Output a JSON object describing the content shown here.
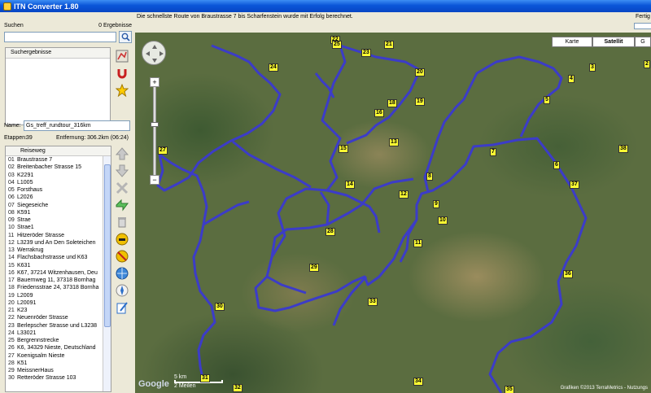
{
  "window": {
    "title": "ITN Converter 1.80"
  },
  "status": {
    "message": "Die schnellste Route von Braustrasse 7 bis Scharfenstein wurde mit Erfolg berechnet.",
    "ready": "Fertig"
  },
  "search": {
    "label": "Suchen",
    "result_count": "0 Ergebnisse",
    "results_header": "Suchergebnisse"
  },
  "route": {
    "name_label": "Name:",
    "name_value": "Gs_treff_rundtour_316km",
    "stages_label": "Etappen:",
    "stages_value": "39",
    "distance_label": "Entfernung:",
    "distance_value": "306.2km (06:24)"
  },
  "list": {
    "header": "Reiseweg",
    "rows": [
      {
        "num": "01",
        "name": "Braustrasse 7"
      },
      {
        "num": "02",
        "name": "Breitenbacher Strasse 15"
      },
      {
        "num": "03",
        "name": "K2291"
      },
      {
        "num": "04",
        "name": "L1005"
      },
      {
        "num": "05",
        "name": "Forsthaus"
      },
      {
        "num": "06",
        "name": "L2026"
      },
      {
        "num": "07",
        "name": "Siegeseiche"
      },
      {
        "num": "08",
        "name": "K591"
      },
      {
        "num": "09",
        "name": "Strae"
      },
      {
        "num": "10",
        "name": "Strae1"
      },
      {
        "num": "11",
        "name": "Hitzeröder Strasse"
      },
      {
        "num": "12",
        "name": "L3239 und An Den Soleteichen"
      },
      {
        "num": "13",
        "name": "Werrakrug"
      },
      {
        "num": "14",
        "name": "Flachsbachstrasse und K63"
      },
      {
        "num": "15",
        "name": "K631"
      },
      {
        "num": "16",
        "name": "K67, 37214 Witzenhausen, Deu"
      },
      {
        "num": "17",
        "name": "Bauernweg 11, 37318 Bornhag"
      },
      {
        "num": "18",
        "name": "Friedensstrae 24, 37318 Bornha"
      },
      {
        "num": "19",
        "name": "L2009"
      },
      {
        "num": "20",
        "name": "L20091"
      },
      {
        "num": "21",
        "name": "K23"
      },
      {
        "num": "22",
        "name": "Neuenröder Strasse"
      },
      {
        "num": "23",
        "name": "Berlepscher Strasse und L3238"
      },
      {
        "num": "24",
        "name": "L33021"
      },
      {
        "num": "25",
        "name": "Bergrennstrecke"
      },
      {
        "num": "26",
        "name": "K6, 34329 Nieste, Deutschland"
      },
      {
        "num": "27",
        "name": "Koenigsalm Nieste"
      },
      {
        "num": "28",
        "name": "K51"
      },
      {
        "num": "29",
        "name": "MeissnerHaus"
      },
      {
        "num": "30",
        "name": "Retteröder Strasse 103"
      }
    ]
  },
  "map": {
    "buttons": {
      "map": "Karte",
      "satellite": "Satellit",
      "extra": "G"
    },
    "google": "Google",
    "scale_km": "5 km",
    "scale_mi": "2 Meilen",
    "copyright": "Grafiken ©2013 TerraMetrics - Nutzungs",
    "markers": [
      "2",
      "3",
      "4",
      "5",
      "6",
      "7",
      "8",
      "9",
      "10",
      "11",
      "12",
      "13",
      "14",
      "15",
      "16",
      "18",
      "19",
      "20",
      "21",
      "22",
      "23",
      "24",
      "25",
      "26",
      "27",
      "28",
      "29",
      "30",
      "31",
      "32",
      "33",
      "34",
      "35",
      "36",
      "37",
      "38"
    ],
    "route_color": "#3c3cc8"
  },
  "colors": {
    "titlebar": "#0a55d8",
    "marker": "#ffff33"
  }
}
